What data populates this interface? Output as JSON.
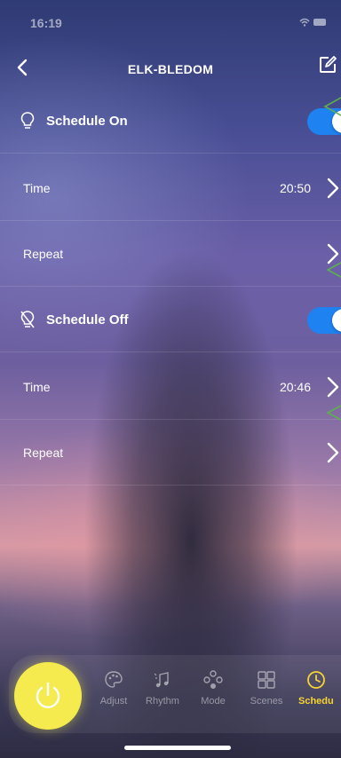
{
  "status_bar": {
    "time": "16:19",
    "icons": "wifi-icon battery-icon"
  },
  "nav": {
    "title": "ELK-BLEDOM"
  },
  "schedule_on": {
    "title": "Schedule On",
    "enabled": true,
    "time_label": "Time",
    "time_value": "20:50",
    "repeat_label": "Repeat"
  },
  "schedule_off": {
    "title": "Schedule Off",
    "enabled": true,
    "time_label": "Time",
    "time_value": "20:46",
    "repeat_label": "Repeat"
  },
  "tabs": [
    {
      "label": "Adjust",
      "icon": "palette-icon",
      "active": false
    },
    {
      "label": "Rhythm",
      "icon": "music-icon",
      "active": false
    },
    {
      "label": "Mode",
      "icon": "mode-icon",
      "active": false
    },
    {
      "label": "Scenes",
      "icon": "scenes-icon",
      "active": false
    },
    {
      "label": "Schedu",
      "icon": "clock-icon",
      "active": true
    }
  ],
  "colors": {
    "toggle_on": "#1e82f0",
    "accent": "#f5d431",
    "power": "#f5ea4e",
    "annotation": "#5fb04b"
  }
}
